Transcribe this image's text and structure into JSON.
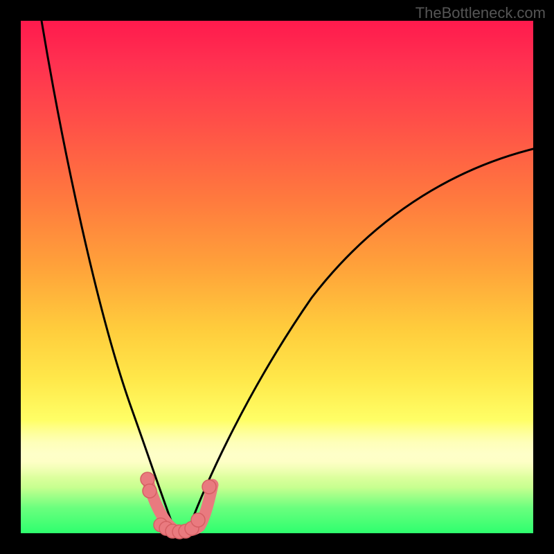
{
  "watermark": "TheBottleneck.com",
  "colors": {
    "frame": "#000000",
    "gradient_top": "#ff1a4d",
    "gradient_mid": "#ffe84a",
    "gradient_bottom": "#2eff6e",
    "curve_stroke": "#000000",
    "marker_fill": "#e97a7f",
    "marker_stroke": "#d55f63"
  },
  "chart_data": {
    "type": "line",
    "title": "",
    "xlabel": "",
    "ylabel": "",
    "xlim": [
      0,
      100
    ],
    "ylim": [
      0,
      100
    ],
    "grid": false,
    "note": "Axes are unlabeled in the image; x/y are normalized 0-100 left→right / bottom→top. Values estimated from pixels.",
    "series": [
      {
        "name": "left-curve",
        "x": [
          4,
          6,
          8,
          10,
          12,
          14,
          16,
          18,
          20,
          22,
          24,
          25,
          26,
          27,
          28,
          29,
          30
        ],
        "y": [
          100,
          86,
          73,
          62,
          52,
          44,
          36,
          30,
          24,
          19,
          14,
          11,
          8,
          6,
          4,
          2,
          0
        ]
      },
      {
        "name": "right-curve",
        "x": [
          32,
          34,
          36,
          39,
          43,
          48,
          54,
          61,
          69,
          78,
          88,
          100
        ],
        "y": [
          0,
          3,
          6,
          10,
          16,
          24,
          33,
          43,
          53,
          62,
          69,
          75
        ]
      },
      {
        "name": "bottom-salmon-band",
        "x": [
          25,
          26,
          27,
          28,
          29,
          30,
          31,
          32,
          33,
          34,
          35,
          36
        ],
        "y": [
          8,
          5,
          3,
          1,
          0,
          0,
          0,
          0,
          0,
          1,
          3,
          7
        ]
      }
    ],
    "markers": [
      {
        "x": 25.0,
        "y": 10.5
      },
      {
        "x": 25.4,
        "y": 8.2
      },
      {
        "x": 27.5,
        "y": 1.6
      },
      {
        "x": 28.5,
        "y": 0.9
      },
      {
        "x": 29.7,
        "y": 0.4
      },
      {
        "x": 31.0,
        "y": 0.2
      },
      {
        "x": 32.3,
        "y": 0.4
      },
      {
        "x": 33.5,
        "y": 1.0
      },
      {
        "x": 34.7,
        "y": 2.6
      },
      {
        "x": 36.8,
        "y": 9.0
      }
    ]
  }
}
